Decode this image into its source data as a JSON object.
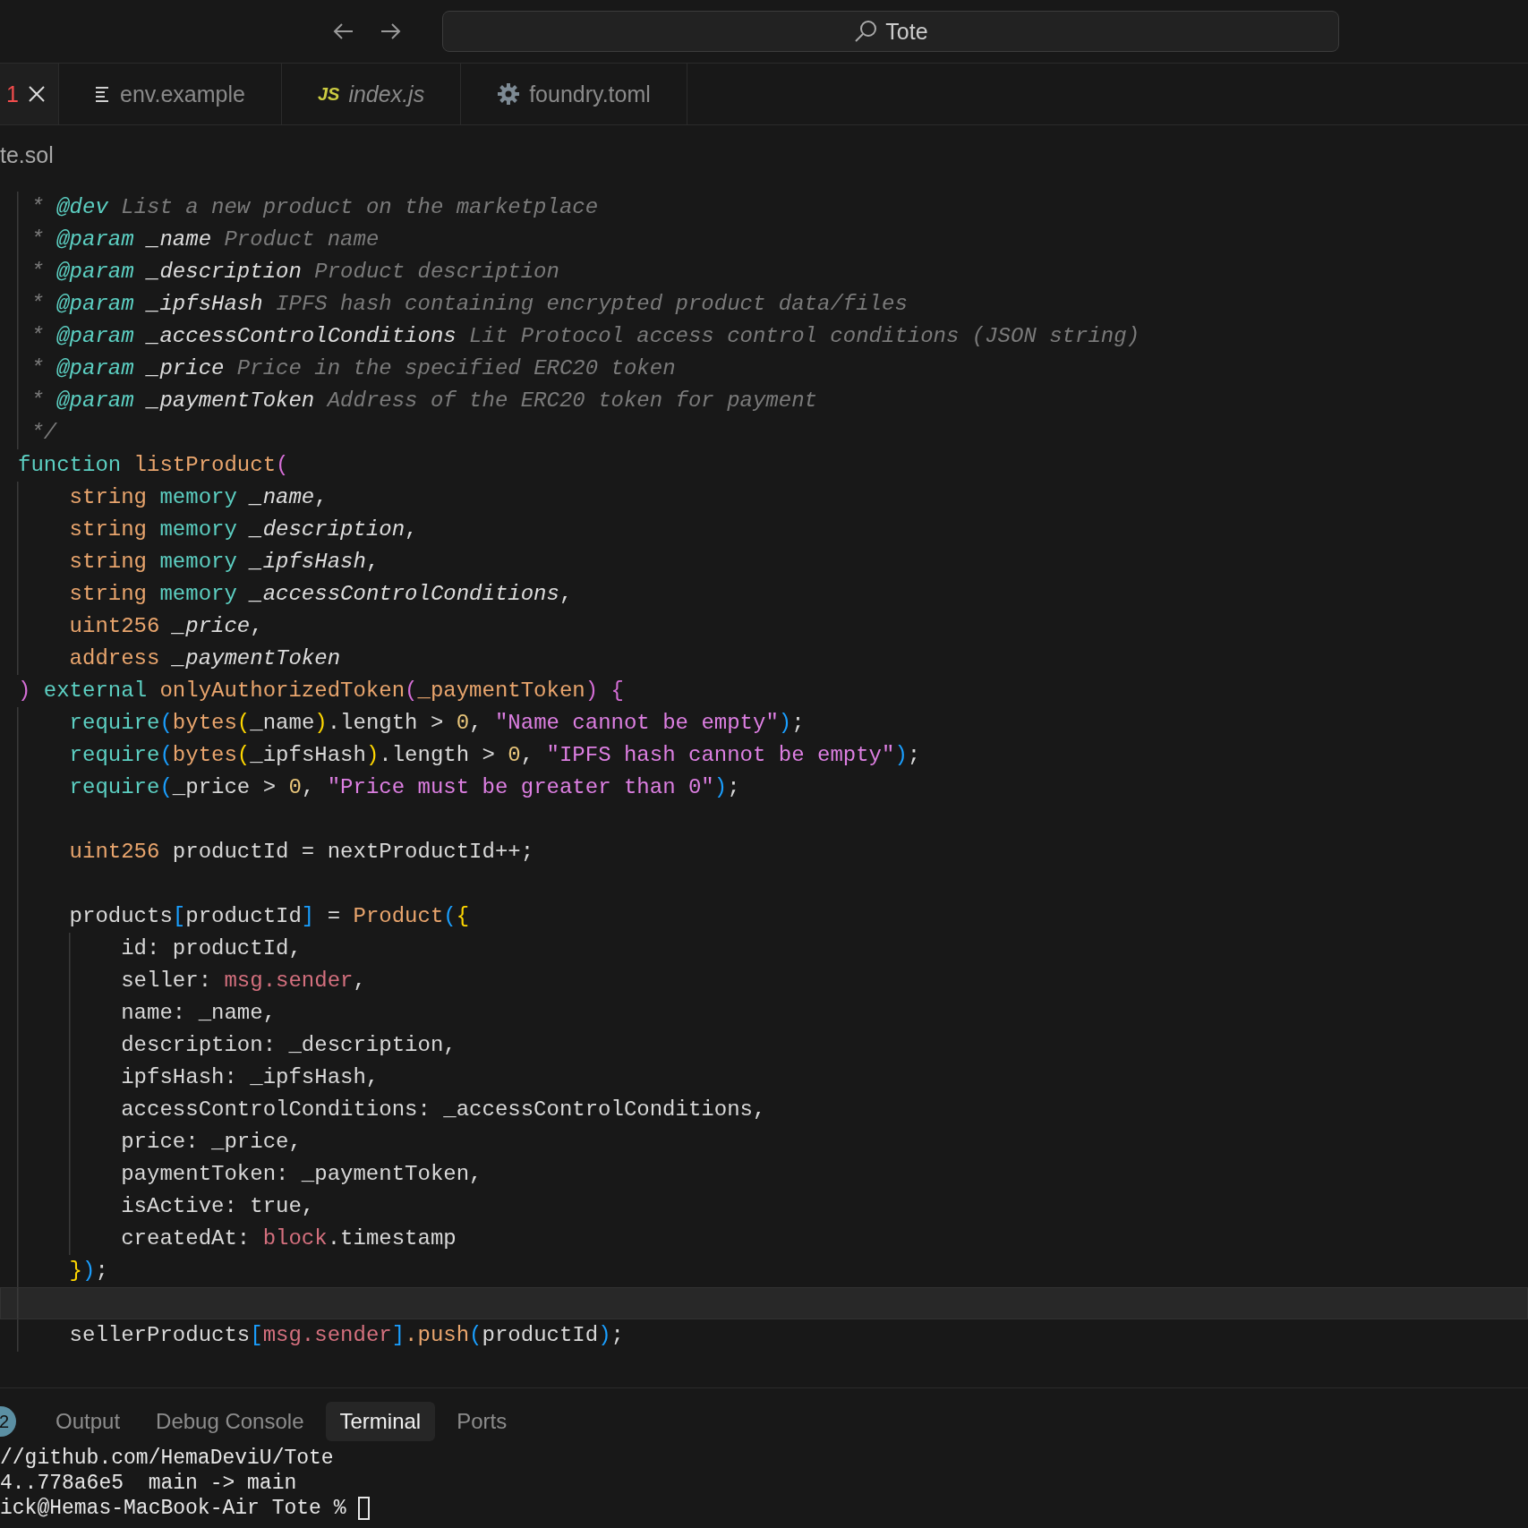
{
  "title_bar": {
    "search": {
      "value": "Tote"
    }
  },
  "tabs": [
    {
      "problems": "1",
      "selected": true,
      "preview": false,
      "kind": "problems"
    },
    {
      "label": "env.example",
      "selected": false,
      "preview": false,
      "kind": "text-file"
    },
    {
      "label": "index.js",
      "icon_text": "JS",
      "selected": false,
      "preview": true,
      "kind": "js"
    },
    {
      "label": "foundry.toml",
      "selected": false,
      "preview": false,
      "kind": "settings"
    }
  ],
  "breadcrumb": "te.sol",
  "code_lines": [
    {
      "current": false,
      "tokens": [
        {
          "text": " * ",
          "kind": "comment"
        },
        {
          "text": "@dev",
          "kind": "tag"
        },
        {
          "text": " List a new product on the marketplace",
          "kind": "comment"
        }
      ]
    },
    {
      "current": false,
      "tokens": [
        {
          "text": " * ",
          "kind": "comment"
        },
        {
          "text": "@param",
          "kind": "tag"
        },
        {
          "text": " _name",
          "kind": "param"
        },
        {
          "text": " Product name",
          "kind": "comment"
        }
      ]
    },
    {
      "current": false,
      "tokens": [
        {
          "text": " * ",
          "kind": "comment"
        },
        {
          "text": "@param",
          "kind": "tag"
        },
        {
          "text": " _description",
          "kind": "param"
        },
        {
          "text": " Product description",
          "kind": "comment"
        }
      ]
    },
    {
      "current": false,
      "tokens": [
        {
          "text": " * ",
          "kind": "comment"
        },
        {
          "text": "@param",
          "kind": "tag"
        },
        {
          "text": " _ipfsHash",
          "kind": "param"
        },
        {
          "text": " IPFS hash containing encrypted product data/files",
          "kind": "comment"
        }
      ]
    },
    {
      "current": false,
      "tokens": [
        {
          "text": " * ",
          "kind": "comment"
        },
        {
          "text": "@param",
          "kind": "tag"
        },
        {
          "text": " _accessControlConditions",
          "kind": "param"
        },
        {
          "text": " Lit Protocol access control conditions (JSON string)",
          "kind": "comment"
        }
      ]
    },
    {
      "current": false,
      "tokens": [
        {
          "text": " * ",
          "kind": "comment"
        },
        {
          "text": "@param",
          "kind": "tag"
        },
        {
          "text": " _price",
          "kind": "param"
        },
        {
          "text": " Price in the specified ERC20 token",
          "kind": "comment"
        }
      ]
    },
    {
      "current": false,
      "tokens": [
        {
          "text": " * ",
          "kind": "comment"
        },
        {
          "text": "@param",
          "kind": "tag"
        },
        {
          "text": " _paymentToken",
          "kind": "param"
        },
        {
          "text": " Address of the ERC20 token for payment",
          "kind": "comment"
        }
      ]
    },
    {
      "current": false,
      "tokens": [
        {
          "text": " */",
          "kind": "comment"
        }
      ]
    },
    {
      "current": false,
      "tokens": [
        {
          "text": "function",
          "kind": "keyword"
        },
        {
          "text": " listProduct",
          "kind": "func"
        },
        {
          "text": "(",
          "kind": "pink"
        }
      ]
    },
    {
      "current": false,
      "tokens": [
        {
          "text": "    string",
          "kind": "type"
        },
        {
          "text": " memory",
          "kind": "keyword"
        },
        {
          "text": " _name",
          "kind": "param"
        },
        {
          "text": ",",
          "kind": "plain"
        }
      ]
    },
    {
      "current": false,
      "tokens": [
        {
          "text": "    string",
          "kind": "type"
        },
        {
          "text": " memory",
          "kind": "keyword"
        },
        {
          "text": " _description",
          "kind": "param"
        },
        {
          "text": ",",
          "kind": "plain"
        }
      ]
    },
    {
      "current": false,
      "tokens": [
        {
          "text": "    string",
          "kind": "type"
        },
        {
          "text": " memory",
          "kind": "keyword"
        },
        {
          "text": " _ipfsHash",
          "kind": "param"
        },
        {
          "text": ",",
          "kind": "plain"
        }
      ]
    },
    {
      "current": false,
      "tokens": [
        {
          "text": "    string",
          "kind": "type"
        },
        {
          "text": " memory",
          "kind": "keyword"
        },
        {
          "text": " _accessControlConditions",
          "kind": "param"
        },
        {
          "text": ",",
          "kind": "plain"
        }
      ]
    },
    {
      "current": false,
      "tokens": [
        {
          "text": "    uint256",
          "kind": "type"
        },
        {
          "text": " _price",
          "kind": "param"
        },
        {
          "text": ",",
          "kind": "plain"
        }
      ]
    },
    {
      "current": false,
      "tokens": [
        {
          "text": "    address",
          "kind": "type"
        },
        {
          "text": " _paymentToken",
          "kind": "param"
        }
      ]
    },
    {
      "current": false,
      "tokens": [
        {
          "text": ")",
          "kind": "pink"
        },
        {
          "text": " external",
          "kind": "keyword"
        },
        {
          "text": " onlyAuthorizedToken",
          "kind": "func"
        },
        {
          "text": "(",
          "kind": "pink"
        },
        {
          "text": "_paymentToken",
          "kind": "func"
        },
        {
          "text": ")",
          "kind": "pink"
        },
        {
          "text": " {",
          "kind": "pink"
        }
      ]
    },
    {
      "current": false,
      "tokens": [
        {
          "text": "    require",
          "kind": "keyword"
        },
        {
          "text": "(",
          "kind": "blue"
        },
        {
          "text": "bytes",
          "kind": "type"
        },
        {
          "text": "(",
          "kind": "yellow"
        },
        {
          "text": "_name",
          "kind": "plain"
        },
        {
          "text": ")",
          "kind": "yellow"
        },
        {
          "text": ".length > ",
          "kind": "plain"
        },
        {
          "text": "0",
          "kind": "number"
        },
        {
          "text": ", ",
          "kind": "plain"
        },
        {
          "text": "\"Name cannot be empty\"",
          "kind": "string"
        },
        {
          "text": ")",
          "kind": "blue"
        },
        {
          "text": ";",
          "kind": "plain"
        }
      ]
    },
    {
      "current": false,
      "tokens": [
        {
          "text": "    require",
          "kind": "keyword"
        },
        {
          "text": "(",
          "kind": "blue"
        },
        {
          "text": "bytes",
          "kind": "type"
        },
        {
          "text": "(",
          "kind": "yellow"
        },
        {
          "text": "_ipfsHash",
          "kind": "plain"
        },
        {
          "text": ")",
          "kind": "yellow"
        },
        {
          "text": ".length > ",
          "kind": "plain"
        },
        {
          "text": "0",
          "kind": "number"
        },
        {
          "text": ", ",
          "kind": "plain"
        },
        {
          "text": "\"IPFS hash cannot be empty\"",
          "kind": "string"
        },
        {
          "text": ")",
          "kind": "blue"
        },
        {
          "text": ";",
          "kind": "plain"
        }
      ]
    },
    {
      "current": false,
      "tokens": [
        {
          "text": "    require",
          "kind": "keyword"
        },
        {
          "text": "(",
          "kind": "blue"
        },
        {
          "text": "_price > ",
          "kind": "plain"
        },
        {
          "text": "0",
          "kind": "number"
        },
        {
          "text": ", ",
          "kind": "plain"
        },
        {
          "text": "\"Price must be greater than 0\"",
          "kind": "string"
        },
        {
          "text": ")",
          "kind": "blue"
        },
        {
          "text": ";",
          "kind": "plain"
        }
      ]
    },
    {
      "current": false
    },
    {
      "current": false,
      "tokens": [
        {
          "text": "    uint256",
          "kind": "type"
        },
        {
          "text": " productId = nextProductId++;",
          "kind": "plain"
        }
      ]
    },
    {
      "current": false
    },
    {
      "current": false,
      "tokens": [
        {
          "text": "    products",
          "kind": "plain"
        },
        {
          "text": "[",
          "kind": "blue"
        },
        {
          "text": "productId",
          "kind": "plain"
        },
        {
          "text": "]",
          "kind": "blue"
        },
        {
          "text": " = ",
          "kind": "plain"
        },
        {
          "text": "Product",
          "kind": "func"
        },
        {
          "text": "(",
          "kind": "blue"
        },
        {
          "text": "{",
          "kind": "yellow"
        }
      ]
    },
    {
      "current": false,
      "tokens": [
        {
          "text": "        id: productId,",
          "kind": "plain"
        }
      ]
    },
    {
      "current": false,
      "tokens": [
        {
          "text": "        seller: ",
          "kind": "plain"
        },
        {
          "text": "msg.sender",
          "kind": "builtin"
        },
        {
          "text": ",",
          "kind": "plain"
        }
      ]
    },
    {
      "current": false,
      "tokens": [
        {
          "text": "        name: _name,",
          "kind": "plain"
        }
      ]
    },
    {
      "current": false,
      "tokens": [
        {
          "text": "        description: _description,",
          "kind": "plain"
        }
      ]
    },
    {
      "current": false,
      "tokens": [
        {
          "text": "        ipfsHash: _ipfsHash,",
          "kind": "plain"
        }
      ]
    },
    {
      "current": false,
      "tokens": [
        {
          "text": "        accessControlConditions: _accessControlConditions,",
          "kind": "plain"
        }
      ]
    },
    {
      "current": false,
      "tokens": [
        {
          "text": "        price: _price,",
          "kind": "plain"
        }
      ]
    },
    {
      "current": false,
      "tokens": [
        {
          "text": "        paymentToken: _paymentToken,",
          "kind": "plain"
        }
      ]
    },
    {
      "current": false,
      "tokens": [
        {
          "text": "        isActive: true,",
          "kind": "plain"
        }
      ]
    },
    {
      "current": false,
      "tokens": [
        {
          "text": "        createdAt: ",
          "kind": "plain"
        },
        {
          "text": "block",
          "kind": "builtin"
        },
        {
          "text": ".timestamp",
          "kind": "plain"
        }
      ]
    },
    {
      "current": false,
      "tokens": [
        {
          "text": "    }",
          "kind": "yellow"
        },
        {
          "text": ")",
          "kind": "blue"
        },
        {
          "text": ";",
          "kind": "plain"
        }
      ]
    },
    {
      "current": true
    },
    {
      "current": false,
      "tokens": [
        {
          "text": "    sellerProducts",
          "kind": "plain"
        },
        {
          "text": "[",
          "kind": "blue"
        },
        {
          "text": "msg.sender",
          "kind": "builtin"
        },
        {
          "text": "]",
          "kind": "blue"
        },
        {
          "text": ".push",
          "kind": "func"
        },
        {
          "text": "(",
          "kind": "blue"
        },
        {
          "text": "productId",
          "kind": "plain"
        },
        {
          "text": ")",
          "kind": "blue"
        },
        {
          "text": ";",
          "kind": "plain"
        }
      ]
    }
  ],
  "panel": {
    "badge": "2",
    "tabs": [
      {
        "label": "Output",
        "selected": false
      },
      {
        "label": "Debug Console",
        "selected": false
      },
      {
        "label": "Terminal",
        "selected": true
      },
      {
        "label": "Ports",
        "selected": false
      }
    ],
    "terminal_lines": [
      {
        "text": "//github.com/HemaDeviU/Tote",
        "cursor": false
      },
      {
        "text": "4..778a6e5  main -> main",
        "cursor": false
      },
      {
        "text": "ick@Hemas-MacBook-Air Tote %",
        "cursor": true
      }
    ]
  }
}
